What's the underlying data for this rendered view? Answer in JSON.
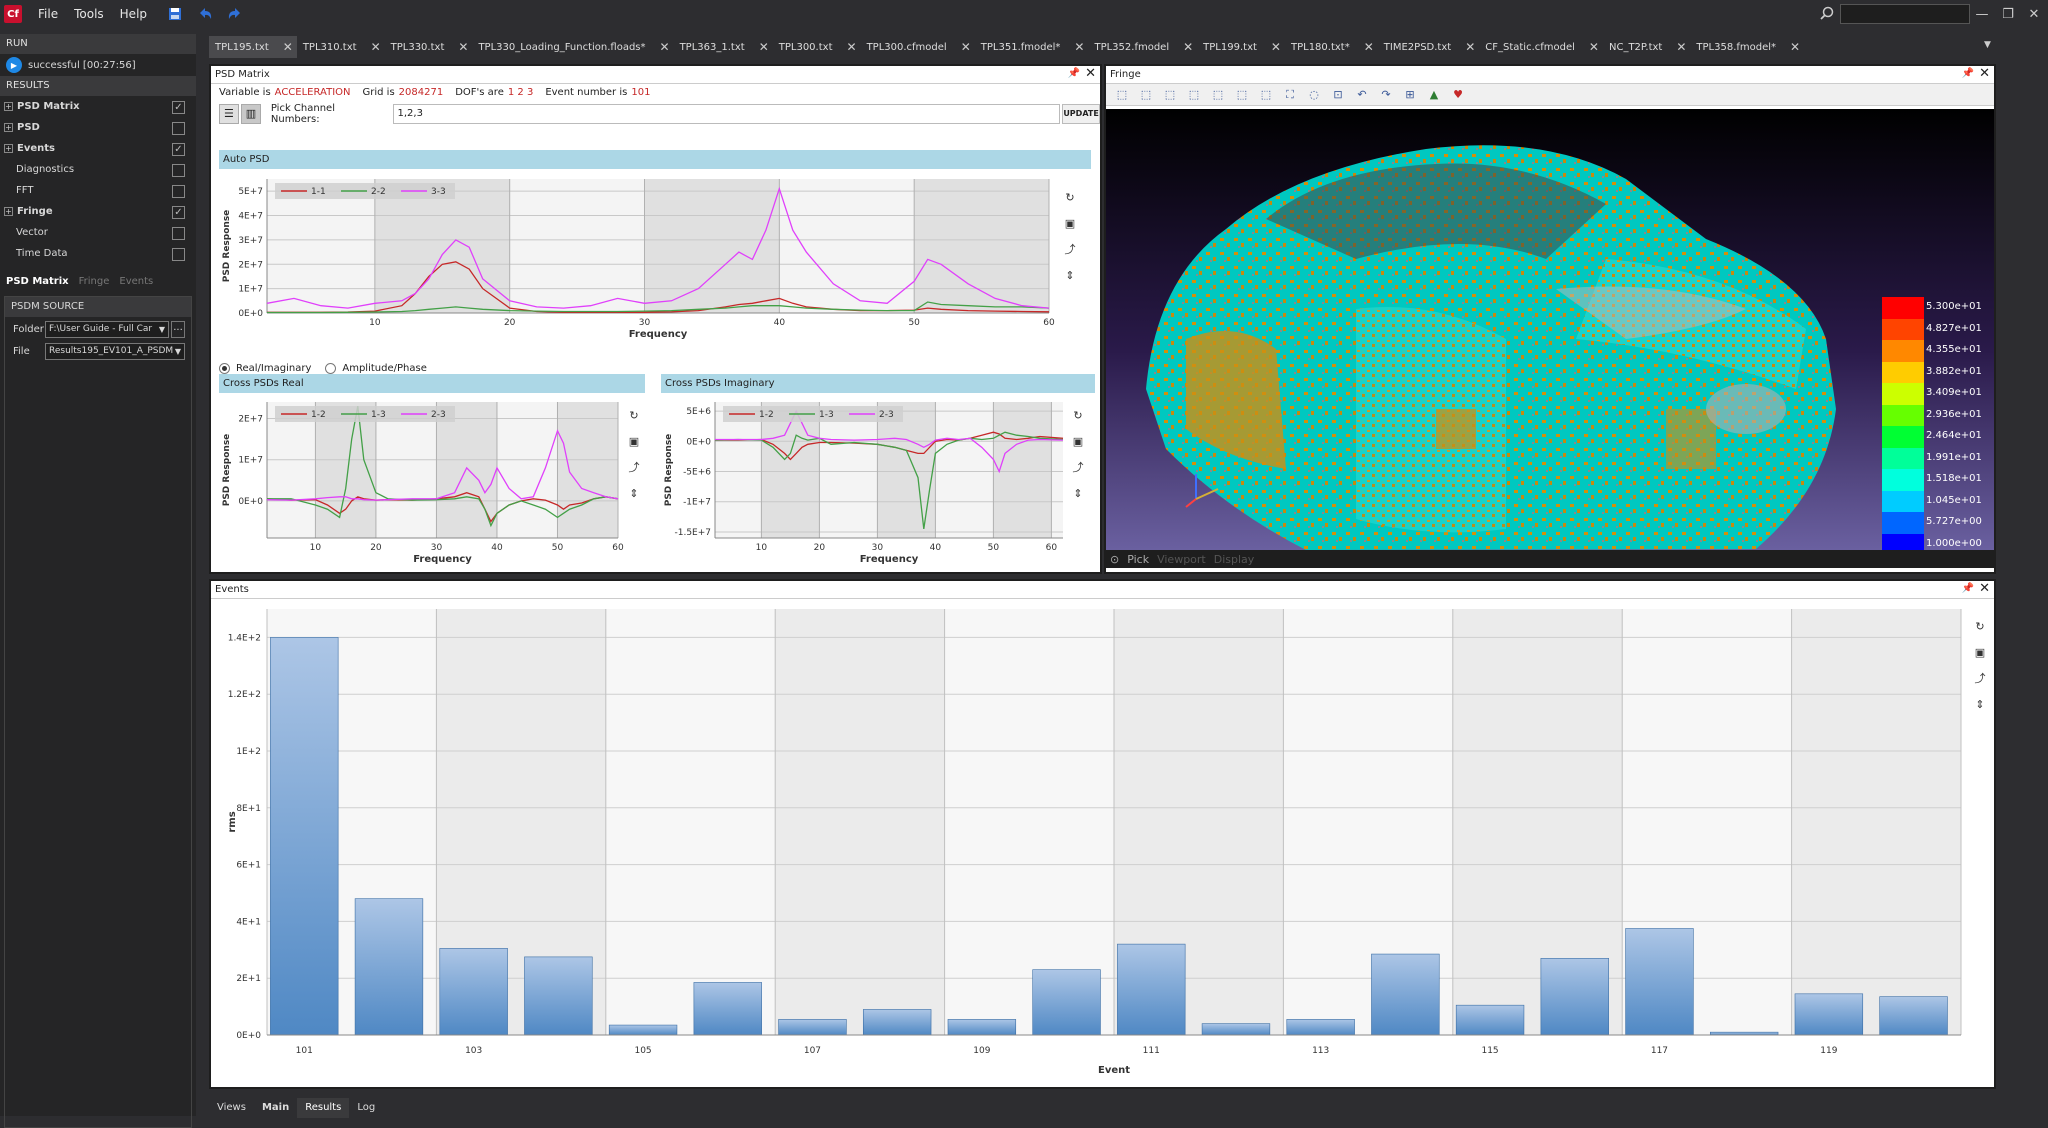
{
  "app": {
    "logo": "Cf"
  },
  "menu": {
    "items": [
      "File",
      "Tools",
      "Help"
    ]
  },
  "left": {
    "run_header": "RUN",
    "run_status": "successful [00:27:56]",
    "results_header": "RESULTS",
    "results": [
      {
        "label": "PSD Matrix",
        "bold": true,
        "expand": true,
        "checked": true
      },
      {
        "label": "PSD",
        "bold": true,
        "expand": true,
        "checked": false
      },
      {
        "label": "Events",
        "bold": true,
        "expand": true,
        "checked": true
      },
      {
        "label": "Diagnostics",
        "bold": false,
        "expand": false,
        "checked": false
      },
      {
        "label": "FFT",
        "bold": false,
        "expand": false,
        "checked": false
      },
      {
        "label": "Fringe",
        "bold": true,
        "expand": true,
        "checked": true
      },
      {
        "label": "Vector",
        "bold": false,
        "expand": false,
        "checked": false
      },
      {
        "label": "Time Data",
        "bold": false,
        "expand": false,
        "checked": false
      }
    ],
    "tabs": [
      "PSD Matrix",
      "Fringe",
      "Events"
    ],
    "psdm_header": "PSDM SOURCE",
    "folder_label": "Folder",
    "folder_value": "F:\\User Guide - Full Car",
    "file_label": "File",
    "file_value": "Results195_EV101_A_PSDM",
    "more_label": "..."
  },
  "file_tabs": [
    "TPL195.txt",
    "TPL310.txt",
    "TPL330.txt",
    "TPL330_Loading_Function.floads*",
    "TPL363_1.txt",
    "TPL300.txt",
    "TPL300.cfmodel",
    "TPL351.fmodel*",
    "TPL352.fmodel",
    "TPL199.txt",
    "TPL180.txt*",
    "TIME2PSD.txt",
    "CF_Static.cfmodel",
    "NC_T2P.txt",
    "TPL358.fmodel*"
  ],
  "close_glyph": "✕",
  "psd": {
    "title": "PSD Matrix",
    "variable_label": "Variable is",
    "variable": "ACCELERATION",
    "grid_label": "Grid is",
    "grid": "2084271",
    "dof_label": "DOF's are",
    "dofs": "1 2 3",
    "event_label": "Event number is",
    "event": "101",
    "pick_label": "Pick Channel Numbers:",
    "pick_value": "1,2,3",
    "update": "UPDATE",
    "auto_title": "Auto PSD",
    "radio_real": "Real/Imaginary",
    "radio_amp": "Amplitude/Phase",
    "cross_real_title": "Cross PSDs   Real",
    "cross_imag_title": "Cross PSDs   Imaginary"
  },
  "fringe": {
    "title": "Fringe",
    "footer": [
      "Pick",
      "Viewport",
      "Display"
    ],
    "legend": [
      {
        "label": "5.300e+01",
        "color": "#ff0000"
      },
      {
        "label": "4.827e+01",
        "color": "#ff4400"
      },
      {
        "label": "4.355e+01",
        "color": "#ff8800"
      },
      {
        "label": "3.882e+01",
        "color": "#ffcc00"
      },
      {
        "label": "3.409e+01",
        "color": "#ccff00"
      },
      {
        "label": "2.936e+01",
        "color": "#66ff00"
      },
      {
        "label": "2.464e+01",
        "color": "#00ff33"
      },
      {
        "label": "1.991e+01",
        "color": "#00ff99"
      },
      {
        "label": "1.518e+01",
        "color": "#00ffdd"
      },
      {
        "label": "1.045e+01",
        "color": "#00ccff"
      },
      {
        "label": "5.727e+00",
        "color": "#0066ff"
      },
      {
        "label": "1.000e+00",
        "color": "#0000ff"
      }
    ]
  },
  "events_panel": {
    "title": "Events"
  },
  "bottom_tabs": [
    "Views",
    "Main",
    "Results",
    "Log"
  ],
  "chart_data": [
    {
      "type": "line",
      "name": "auto-psd",
      "xlabel": "Frequency",
      "ylabel": "PSD Response",
      "xlim": [
        2,
        60
      ],
      "ylim": [
        0,
        55000000
      ],
      "xticks": [
        "10",
        "20",
        "30",
        "40",
        "50",
        "60"
      ],
      "yticks": [
        "0E+0",
        "1E+7",
        "2E+7",
        "3E+7",
        "4E+7",
        "5E+7"
      ],
      "x": [
        2,
        4,
        6,
        8,
        10,
        12,
        13,
        14,
        15,
        16,
        17,
        18,
        20,
        22,
        24,
        26,
        28,
        30,
        32,
        34,
        36,
        37,
        38,
        39,
        40,
        41,
        42,
        44,
        46,
        48,
        50,
        51,
        52,
        54,
        56,
        58,
        60
      ],
      "series": [
        {
          "name": "1-1",
          "color": "#c62828",
          "values": [
            300000.0,
            300000.0,
            300000.0,
            400000.0,
            800000.0,
            3000000.0,
            8000000.0,
            15000000.0,
            20000000.0,
            21000000.0,
            18000000.0,
            10000000.0,
            2000000.0,
            600000.0,
            300000.0,
            300000.0,
            300000.0,
            300000.0,
            500000.0,
            1000000.0,
            2500000.0,
            3500000.0,
            4000000.0,
            5000000.0,
            6000000.0,
            4000000.0,
            2500000.0,
            1500000.0,
            1000000.0,
            1000000.0,
            1200000.0,
            2000000.0,
            1500000.0,
            1000000.0,
            800000.0,
            600000.0,
            500000.0
          ]
        },
        {
          "name": "2-2",
          "color": "#43a047",
          "values": [
            200000.0,
            200000.0,
            200000.0,
            300000.0,
            400000.0,
            600000.0,
            1000000.0,
            1500000.0,
            2000000.0,
            2500000.0,
            2000000.0,
            1500000.0,
            1000000.0,
            800000.0,
            600000.0,
            600000.0,
            600000.0,
            800000.0,
            1000000.0,
            1500000.0,
            2000000.0,
            2500000.0,
            3000000.0,
            3000000.0,
            3000000.0,
            2500000.0,
            2000000.0,
            1500000.0,
            1200000.0,
            1000000.0,
            1000000.0,
            4500000.0,
            3500000.0,
            3000000.0,
            2500000.0,
            2500000.0,
            2000000.0
          ]
        },
        {
          "name": "3-3",
          "color": "#e040fb",
          "values": [
            4000000.0,
            6000000.0,
            3000000.0,
            2000000.0,
            4000000.0,
            5000000.0,
            8000000.0,
            14000000.0,
            24000000.0,
            30000000.0,
            27000000.0,
            14000000.0,
            5000000.0,
            2500000.0,
            2000000.0,
            3000000.0,
            6000000.0,
            4000000.0,
            5000000.0,
            10000000.0,
            20000000.0,
            25000000.0,
            22000000.0,
            34000000.0,
            51000000.0,
            34000000.0,
            25000000.0,
            12000000.0,
            5000000.0,
            4000000.0,
            13000000.0,
            22000000.0,
            20000000.0,
            12000000.0,
            6000000.0,
            3000000.0,
            2000000.0
          ]
        }
      ]
    },
    {
      "type": "line",
      "name": "cross-real",
      "xlabel": "Frequency",
      "ylabel": "PSD Response",
      "xlim": [
        2,
        60
      ],
      "ylim": [
        -9000000,
        24000000
      ],
      "xticks": [
        "10",
        "20",
        "30",
        "40",
        "50",
        "60"
      ],
      "yticks": [
        "0E+0",
        "1E+7",
        "2E+7"
      ],
      "x": [
        2,
        6,
        10,
        12,
        14,
        15,
        16,
        17,
        18,
        20,
        22,
        26,
        30,
        33,
        35,
        37,
        38,
        39,
        40,
        42,
        44,
        46,
        48,
        50,
        51,
        52,
        54,
        56,
        58,
        60
      ],
      "series": [
        {
          "name": "1-2",
          "color": "#c62828",
          "values": [
            500000.0,
            200000.0,
            300000.0,
            -1000000.0,
            -3000000.0,
            -2000000.0,
            0,
            1000000.0,
            500000.0,
            200000.0,
            300000.0,
            200000.0,
            500000.0,
            1000000.0,
            2000000.0,
            1000000.0,
            -2000000.0,
            -5000000.0,
            -3000000.0,
            -1000000.0,
            0,
            500000.0,
            200000.0,
            -1000000.0,
            -2000000.0,
            -1000000.0,
            -500000.0,
            500000.0,
            1000000.0,
            500000.0
          ]
        },
        {
          "name": "1-3",
          "color": "#43a047",
          "values": [
            500000.0,
            500000.0,
            -1000000.0,
            -2000000.0,
            -4000000.0,
            3000000.0,
            15000000.0,
            23000000.0,
            10000000.0,
            2000000.0,
            500000.0,
            200000.0,
            300000.0,
            500000.0,
            1000000.0,
            500000.0,
            -2000000.0,
            -6000000.0,
            -3000000.0,
            -1000000.0,
            0,
            -1000000.0,
            -2000000.0,
            -4000000.0,
            -3000000.0,
            -2000000.0,
            -1000000.0,
            500000.0,
            1000000.0,
            500000.0
          ]
        },
        {
          "name": "2-3",
          "color": "#e040fb",
          "values": [
            300000.0,
            200000.0,
            500000.0,
            800000.0,
            1000000.0,
            1000000.0,
            500000.0,
            500000.0,
            300000.0,
            200000.0,
            300000.0,
            500000.0,
            500000.0,
            2000000.0,
            8000000.0,
            5000000.0,
            2000000.0,
            4000000.0,
            8000000.0,
            3000000.0,
            500000.0,
            1000000.0,
            8000000.0,
            17000000.0,
            14000000.0,
            7000000.0,
            3000000.0,
            2000000.0,
            1000000.0,
            500000.0
          ]
        }
      ]
    },
    {
      "type": "line",
      "name": "cross-imag",
      "xlabel": "Frequency",
      "ylabel": "PSD Response",
      "xlim": [
        2,
        62
      ],
      "ylim": [
        -16000000,
        6500000
      ],
      "xticks": [
        "10",
        "20",
        "30",
        "40",
        "50",
        "60"
      ],
      "yticks": [
        "-1.5E+7",
        "-1E+7",
        "-5E+6",
        "0E+0",
        "5E+6"
      ],
      "x": [
        2,
        6,
        10,
        12,
        14,
        15,
        16,
        17,
        18,
        20,
        22,
        26,
        30,
        33,
        35,
        37,
        38,
        39,
        40,
        42,
        44,
        46,
        48,
        50,
        51,
        52,
        54,
        56,
        58,
        62
      ],
      "series": [
        {
          "name": "1-2",
          "color": "#c62828",
          "values": [
            200000.0,
            200000.0,
            300000.0,
            -500000.0,
            -2000000.0,
            -3000000.0,
            -2000000.0,
            -1000000.0,
            -500000.0,
            -200000.0,
            -200000.0,
            -300000.0,
            -500000.0,
            -1000000.0,
            -1500000.0,
            -2000000.0,
            -2000000.0,
            -1000000.0,
            0,
            300000.0,
            200000.0,
            500000.0,
            1000000.0,
            1500000.0,
            1200000.0,
            500000.0,
            300000.0,
            500000.0,
            800000.0,
            500000.0
          ]
        },
        {
          "name": "1-3",
          "color": "#43a047",
          "values": [
            200000.0,
            300000.0,
            200000.0,
            -1000000.0,
            -3000000.0,
            -2000000.0,
            1000000.0,
            500000.0,
            200000.0,
            500000.0,
            -500000.0,
            -200000.0,
            -500000.0,
            -1000000.0,
            -1500000.0,
            -6000000.0,
            -14500000.0,
            -8000000.0,
            -2000000.0,
            -500000.0,
            200000.0,
            500000.0,
            300000.0,
            500000.0,
            1000000.0,
            1500000.0,
            1000000.0,
            800000.0,
            500000.0,
            300000.0
          ]
        },
        {
          "name": "2-3",
          "color": "#e040fb",
          "values": [
            300000.0,
            300000.0,
            300000.0,
            500000.0,
            1000000.0,
            3000000.0,
            5000000.0,
            3000000.0,
            1000000.0,
            500000.0,
            300000.0,
            200000.0,
            300000.0,
            500000.0,
            300000.0,
            -500000.0,
            -1000000.0,
            -500000.0,
            200000.0,
            500000.0,
            300000.0,
            500000.0,
            -1000000.0,
            -3000000.0,
            -5000000.0,
            -2000000.0,
            -500000.0,
            200000.0,
            300000.0,
            200000.0
          ]
        }
      ]
    },
    {
      "type": "bar",
      "name": "events-rms",
      "xlabel": "Event",
      "ylabel": "rms",
      "ylim": [
        0,
        150
      ],
      "categories": [
        "101",
        "102",
        "103",
        "104",
        "105",
        "106",
        "107",
        "108",
        "109",
        "110",
        "111",
        "112",
        "113",
        "114",
        "115",
        "116",
        "117",
        "118",
        "119",
        "120"
      ],
      "xtick_labels": [
        "101",
        "103",
        "105",
        "107",
        "109",
        "111",
        "113",
        "115",
        "117",
        "119"
      ],
      "yticks": [
        "0E+0",
        "2E+1",
        "4E+1",
        "6E+1",
        "8E+1",
        "1E+2",
        "1.2E+2",
        "1.4E+2"
      ],
      "values": [
        140,
        48,
        30.5,
        27.5,
        3.5,
        18.5,
        5.5,
        9,
        5.5,
        23,
        32,
        4,
        5.5,
        28.5,
        10.5,
        27,
        37.5,
        1,
        14.5,
        13.5
      ]
    }
  ]
}
